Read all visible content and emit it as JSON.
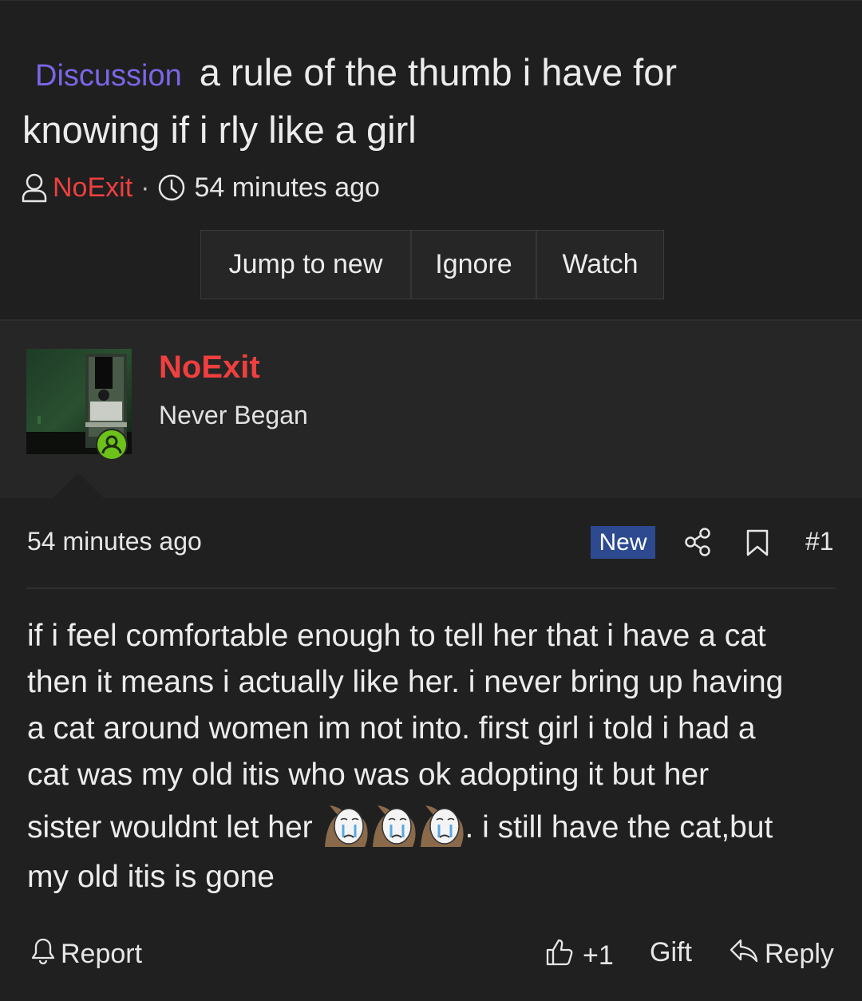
{
  "thread": {
    "prefix": "Discussion",
    "title_line1": "a rule of the thumb i have for",
    "title_line2": "knowing if i rly like a girl",
    "author": "NoExit",
    "separator": "·",
    "time": "54 minutes ago"
  },
  "actions": {
    "jump": "Jump to new",
    "ignore": "Ignore",
    "watch": "Watch"
  },
  "user": {
    "name": "NoExit",
    "title": "Never Began",
    "online": true
  },
  "post": {
    "time": "54 minutes ago",
    "badge": "New",
    "number": "#1",
    "lines": [
      "if i feel comfortable enough to tell her that i have a cat",
      "then it means i actually like her. i never bring up having",
      "a cat around women im not into. first girl i told i had a",
      "cat was my old itis who was ok adopting it but her"
    ],
    "line5_before": "sister wouldnt let her",
    "line5_after": ". i still have the cat,but",
    "line6": "my old itis is gone",
    "emoji_count": 3,
    "emoji_name": "crying-wojak"
  },
  "footer": {
    "report": "Report",
    "reactions": "+1",
    "gift": "Gift",
    "reply": "Reply"
  },
  "colors": {
    "background": "#202020",
    "accent_purple": "#7a66e6",
    "username_red": "#ef3f3f",
    "badge_blue": "#2d4a90",
    "presence_green": "#6cc11a"
  }
}
